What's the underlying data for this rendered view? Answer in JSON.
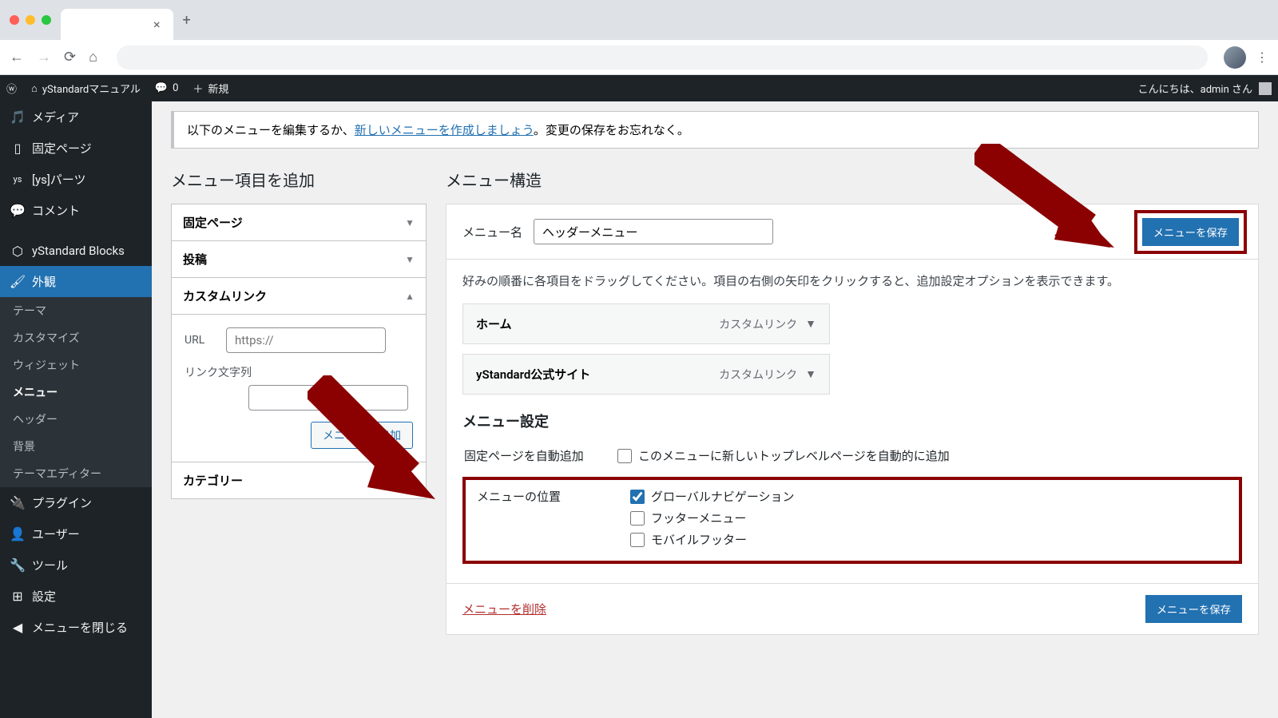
{
  "browser": {
    "tab_close": "×",
    "new_tab": "+"
  },
  "adminbar": {
    "site_name": "yStandardマニュアル",
    "comments_count": "0",
    "new_label": "新規",
    "greeting": "こんにちは、admin さん"
  },
  "sidebar": {
    "media": "メディア",
    "fixed_pages": "固定ページ",
    "ys_parts": "[ys]パーツ",
    "comments": "コメント",
    "ystandard_blocks": "yStandard Blocks",
    "appearance": "外観",
    "sub_theme": "テーマ",
    "sub_customize": "カスタマイズ",
    "sub_widget": "ウィジェット",
    "sub_menu": "メニュー",
    "sub_header": "ヘッダー",
    "sub_background": "背景",
    "sub_theme_editor": "テーマエディター",
    "plugins": "プラグイン",
    "users": "ユーザー",
    "tools": "ツール",
    "settings": "設定",
    "collapse": "メニューを閉じる"
  },
  "main": {
    "notice_prefix": "以下のメニューを編集するか、",
    "notice_link": "新しいメニューを作成しましょう",
    "notice_suffix": "。変更の保存をお忘れなく。",
    "add_menu_items": "メニュー項目を追加",
    "menu_structure": "メニュー構造",
    "acc_fixed_pages": "固定ページ",
    "acc_posts": "投稿",
    "acc_custom_link": "カスタムリンク",
    "acc_categories": "カテゴリー",
    "url_label": "URL",
    "url_placeholder": "https://",
    "link_text_label": "リンク文字列",
    "add_to_menu_btn": "メニューに追加",
    "menu_name_label": "メニュー名",
    "menu_name_value": "ヘッダーメニュー",
    "save_menu_btn": "メニューを保存",
    "drag_instruction": "好みの順番に各項目をドラッグしてください。項目の右側の矢印をクリックすると、追加設定オプションを表示できます。",
    "items": [
      {
        "title": "ホーム",
        "type": "カスタムリンク"
      },
      {
        "title": "yStandard公式サイト",
        "type": "カスタムリンク"
      }
    ],
    "menu_settings": "メニュー設定",
    "auto_add_label": "固定ページを自動追加",
    "auto_add_desc": "このメニューに新しいトップレベルページを自動的に追加",
    "location_label": "メニューの位置",
    "loc_global": "グローバルナビゲーション",
    "loc_footer": "フッターメニュー",
    "loc_mobile": "モバイルフッター",
    "delete_menu": "メニューを削除"
  }
}
